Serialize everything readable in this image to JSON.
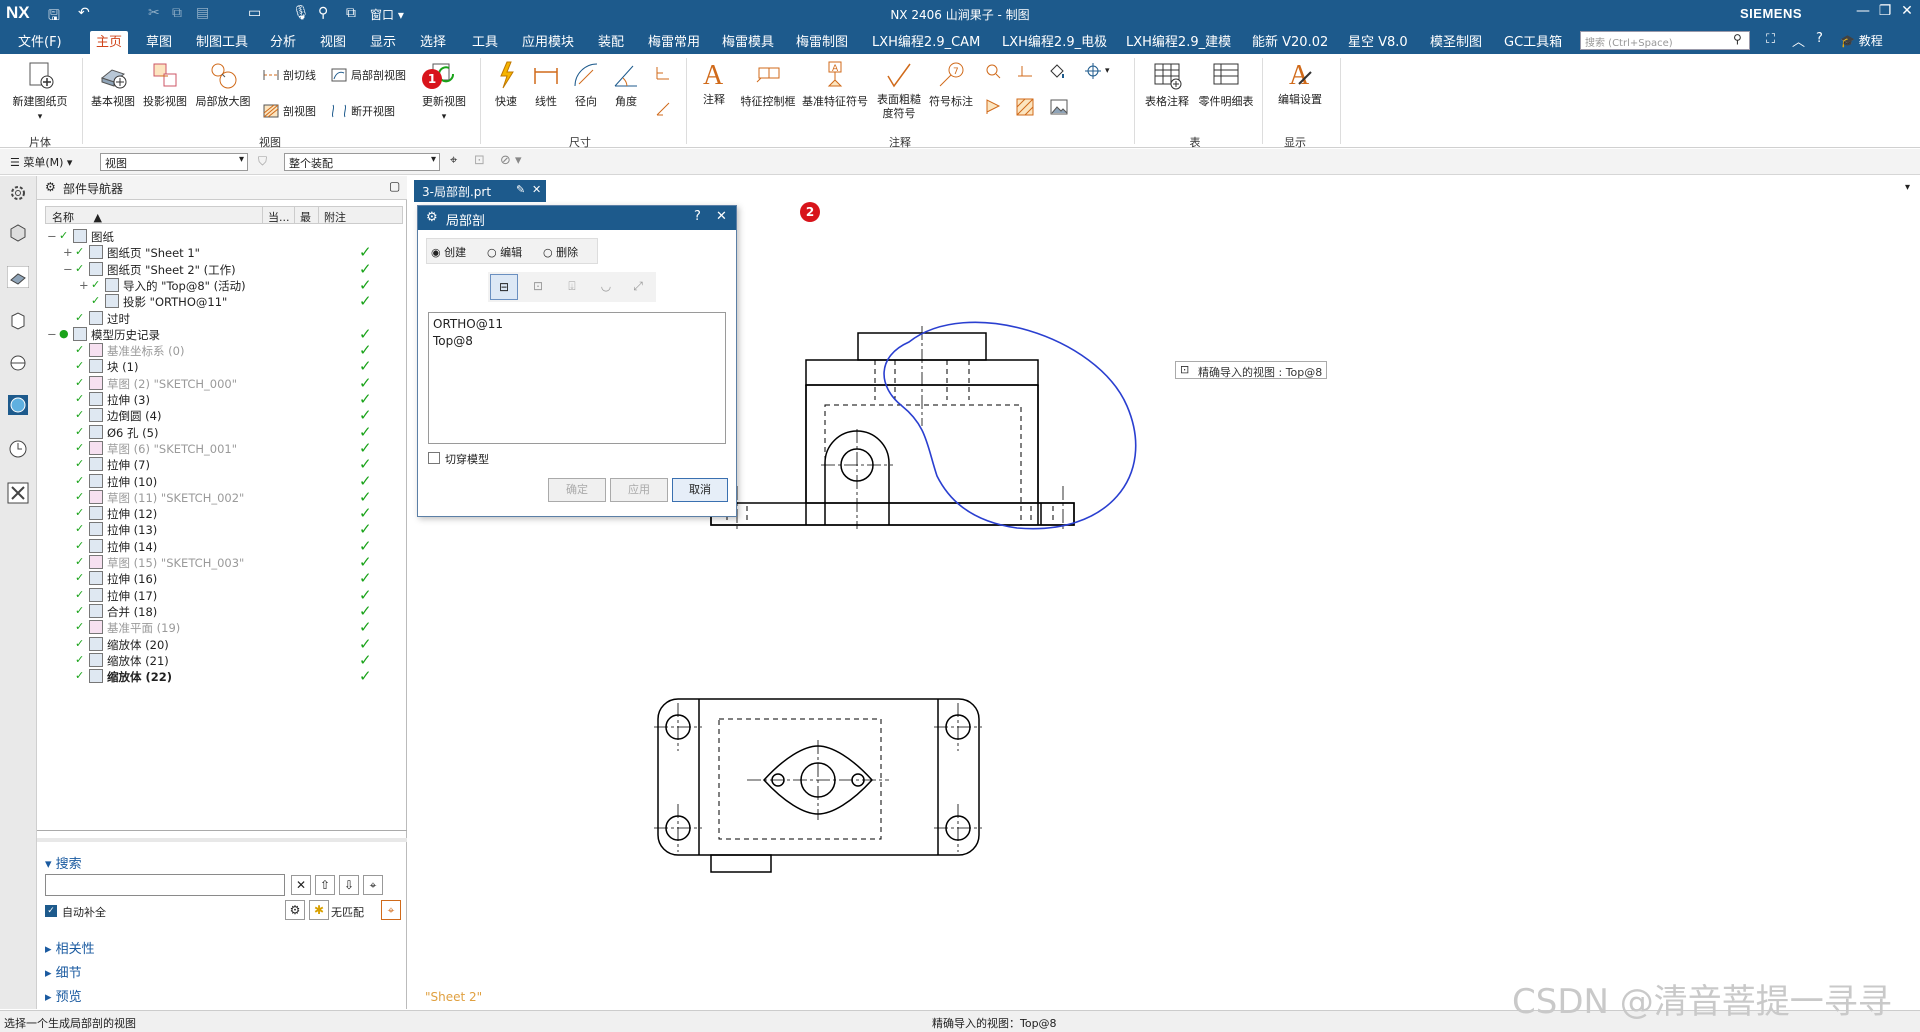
{
  "titlebar": {
    "logo": "NX",
    "title": "NX 2406 山涧果子 - 制图",
    "brand": "SIEMENS",
    "window_menu": "窗口"
  },
  "menu": {
    "file": "文件(F)",
    "tabs": [
      "主页",
      "草图",
      "制图工具",
      "分析",
      "视图",
      "显示",
      "选择",
      "工具",
      "应用模块",
      "装配",
      "梅雷常用",
      "梅雷模具",
      "梅雷制图",
      "LXH编程2.9_CAM",
      "LXH编程2.9_电极",
      "LXH编程2.9_建模",
      "能新 V20.02",
      "星空 V8.0",
      "模圣制图",
      "GC工具箱"
    ],
    "search_placeholder": "搜索 (Ctrl+Space)",
    "tutorial": "教程"
  },
  "ribbon": {
    "sheet": {
      "new_sheet": "新建图纸页",
      "group": "片体"
    },
    "views": {
      "base": "基本视图",
      "projected": "投影视图",
      "detail": "局部放大图",
      "section_line": "剖切线",
      "section": "剖视图",
      "partial_section": "局部剖视图",
      "break": "断开视图",
      "update": "更新视图",
      "group": "视图"
    },
    "dimension": {
      "rapid": "快速",
      "linear": "线性",
      "radial": "径向",
      "angular": "角度",
      "group": "尺寸"
    },
    "annotation": {
      "note": "注释",
      "fcf": "特征控制框",
      "datum": "基准特征符号",
      "surface1": "表面粗糙",
      "surface2": "度符号",
      "id_symbol": "符号标注",
      "group": "注释"
    },
    "table": {
      "tabular": "表格注释",
      "parts_list": "零件明细表",
      "group": "表"
    },
    "display": {
      "edit_settings": "编辑设置",
      "group": "显示"
    }
  },
  "toolbar2": {
    "menu": "菜单(M)",
    "filter": "视图",
    "scope": "整个装配"
  },
  "navigator": {
    "title": "部件导航器",
    "columns": {
      "name": "名称",
      "current": "当...",
      "latest": "最",
      "attach": "附注"
    },
    "nodes": [
      {
        "label": "图纸",
        "indent": 0,
        "check": false,
        "style": "normal"
      },
      {
        "label": "图纸页 \"Sheet 1\"",
        "indent": 1,
        "check": true,
        "style": "normal"
      },
      {
        "label": "图纸页 \"Sheet 2\" (工作)",
        "indent": 1,
        "check": true,
        "style": "normal"
      },
      {
        "label": "导入的 \"Top@8\" (活动)",
        "indent": 2,
        "check": true,
        "style": "normal"
      },
      {
        "label": "投影 \"ORTHO@11\"",
        "indent": 2,
        "check": true,
        "style": "normal"
      },
      {
        "label": "过时",
        "indent": 1,
        "check": false,
        "style": "normal"
      },
      {
        "label": "模型历史记录",
        "indent": 0,
        "check": true,
        "style": "normal"
      },
      {
        "label": "基准坐标系 (0)",
        "indent": 1,
        "check": true,
        "style": "grey"
      },
      {
        "label": "块 (1)",
        "indent": 1,
        "check": true,
        "style": "normal"
      },
      {
        "label": "草图 (2) \"SKETCH_000\"",
        "indent": 1,
        "check": true,
        "style": "grey"
      },
      {
        "label": "拉伸 (3)",
        "indent": 1,
        "check": true,
        "style": "normal"
      },
      {
        "label": "边倒圆 (4)",
        "indent": 1,
        "check": true,
        "style": "normal"
      },
      {
        "label": "Ø6 孔 (5)",
        "indent": 1,
        "check": true,
        "style": "normal"
      },
      {
        "label": "草图 (6) \"SKETCH_001\"",
        "indent": 1,
        "check": true,
        "style": "grey"
      },
      {
        "label": "拉伸 (7)",
        "indent": 1,
        "check": true,
        "style": "normal"
      },
      {
        "label": "拉伸 (10)",
        "indent": 1,
        "check": true,
        "style": "normal"
      },
      {
        "label": "草图 (11) \"SKETCH_002\"",
        "indent": 1,
        "check": true,
        "style": "grey"
      },
      {
        "label": "拉伸 (12)",
        "indent": 1,
        "check": true,
        "style": "normal"
      },
      {
        "label": "拉伸 (13)",
        "indent": 1,
        "check": true,
        "style": "normal"
      },
      {
        "label": "拉伸 (14)",
        "indent": 1,
        "check": true,
        "style": "normal"
      },
      {
        "label": "草图 (15) \"SKETCH_003\"",
        "indent": 1,
        "check": true,
        "style": "grey"
      },
      {
        "label": "拉伸 (16)",
        "indent": 1,
        "check": true,
        "style": "normal"
      },
      {
        "label": "拉伸 (17)",
        "indent": 1,
        "check": true,
        "style": "normal"
      },
      {
        "label": "合并 (18)",
        "indent": 1,
        "check": true,
        "style": "normal"
      },
      {
        "label": "基准平面 (19)",
        "indent": 1,
        "check": true,
        "style": "grey"
      },
      {
        "label": "缩放体 (20)",
        "indent": 1,
        "check": true,
        "style": "normal"
      },
      {
        "label": "缩放体 (21)",
        "indent": 1,
        "check": true,
        "style": "normal"
      },
      {
        "label": "缩放体 (22)",
        "indent": 1,
        "check": true,
        "style": "bold"
      }
    ],
    "search": {
      "title": "搜索",
      "auto_complete": "自动补全",
      "no_match": "无匹配"
    },
    "sections": [
      "相关性",
      "细节",
      "预览"
    ]
  },
  "doc_tab": "3-局部剖.prt",
  "dialog": {
    "title": "局部剖",
    "radio_create": "创建",
    "radio_edit": "编辑",
    "radio_delete": "删除",
    "views": [
      "ORTHO@11",
      "Top@8"
    ],
    "cut_model": "切穿模型",
    "ok": "确定",
    "apply": "应用",
    "cancel": "取消"
  },
  "tooltip": "精确导入的视图 : Top@8",
  "sheet_label": "\"Sheet 2\"",
  "statusbar": {
    "left": "选择一个生成局部剖的视图",
    "center": "精确导入的视图：Top@8"
  },
  "badges": [
    "1",
    "2"
  ],
  "watermark": "CSDN @清音菩提一寻寻",
  "colors": {
    "accent": "#1d5a8c",
    "active_tab": "#d0451b",
    "badge": "#d8141b",
    "spline": "#2a3fd0",
    "check": "#1aa31a"
  }
}
